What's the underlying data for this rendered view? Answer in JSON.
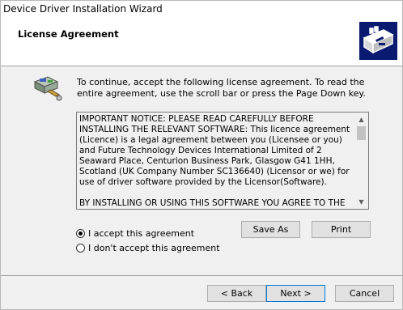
{
  "window": {
    "title": "Device Driver Installation Wizard"
  },
  "header": {
    "heading": "License Agreement"
  },
  "instructions": "To continue, accept the following license agreement. To read the entire agreement, use the scroll bar or press the Page Down key.",
  "license": {
    "paragraphs": [
      "IMPORTANT NOTICE: PLEASE READ CAREFULLY BEFORE INSTALLING THE RELEVANT SOFTWARE: This licence agreement (Licence) is a legal agreement between you (Licensee or you) and Future Technology Devices International Limited of 2 Seaward Place, Centurion Business Park, Glasgow G41 1HH, Scotland (UK Company Number SC136640) (Licensor or we) for use of driver software provided by the Licensor(Software).",
      "BY INSTALLING OR USING THIS SOFTWARE YOU AGREE TO THE"
    ]
  },
  "buttons": {
    "save_as": "Save As",
    "print": "Print",
    "back": "< Back",
    "next": "Next >",
    "cancel": "Cancel"
  },
  "options": {
    "accept": "I accept this agreement",
    "decline": "I don't accept this agreement",
    "selected": "accept"
  },
  "colors": {
    "logo_background": "#0a1a70",
    "default_button_border": "#0078d7"
  }
}
